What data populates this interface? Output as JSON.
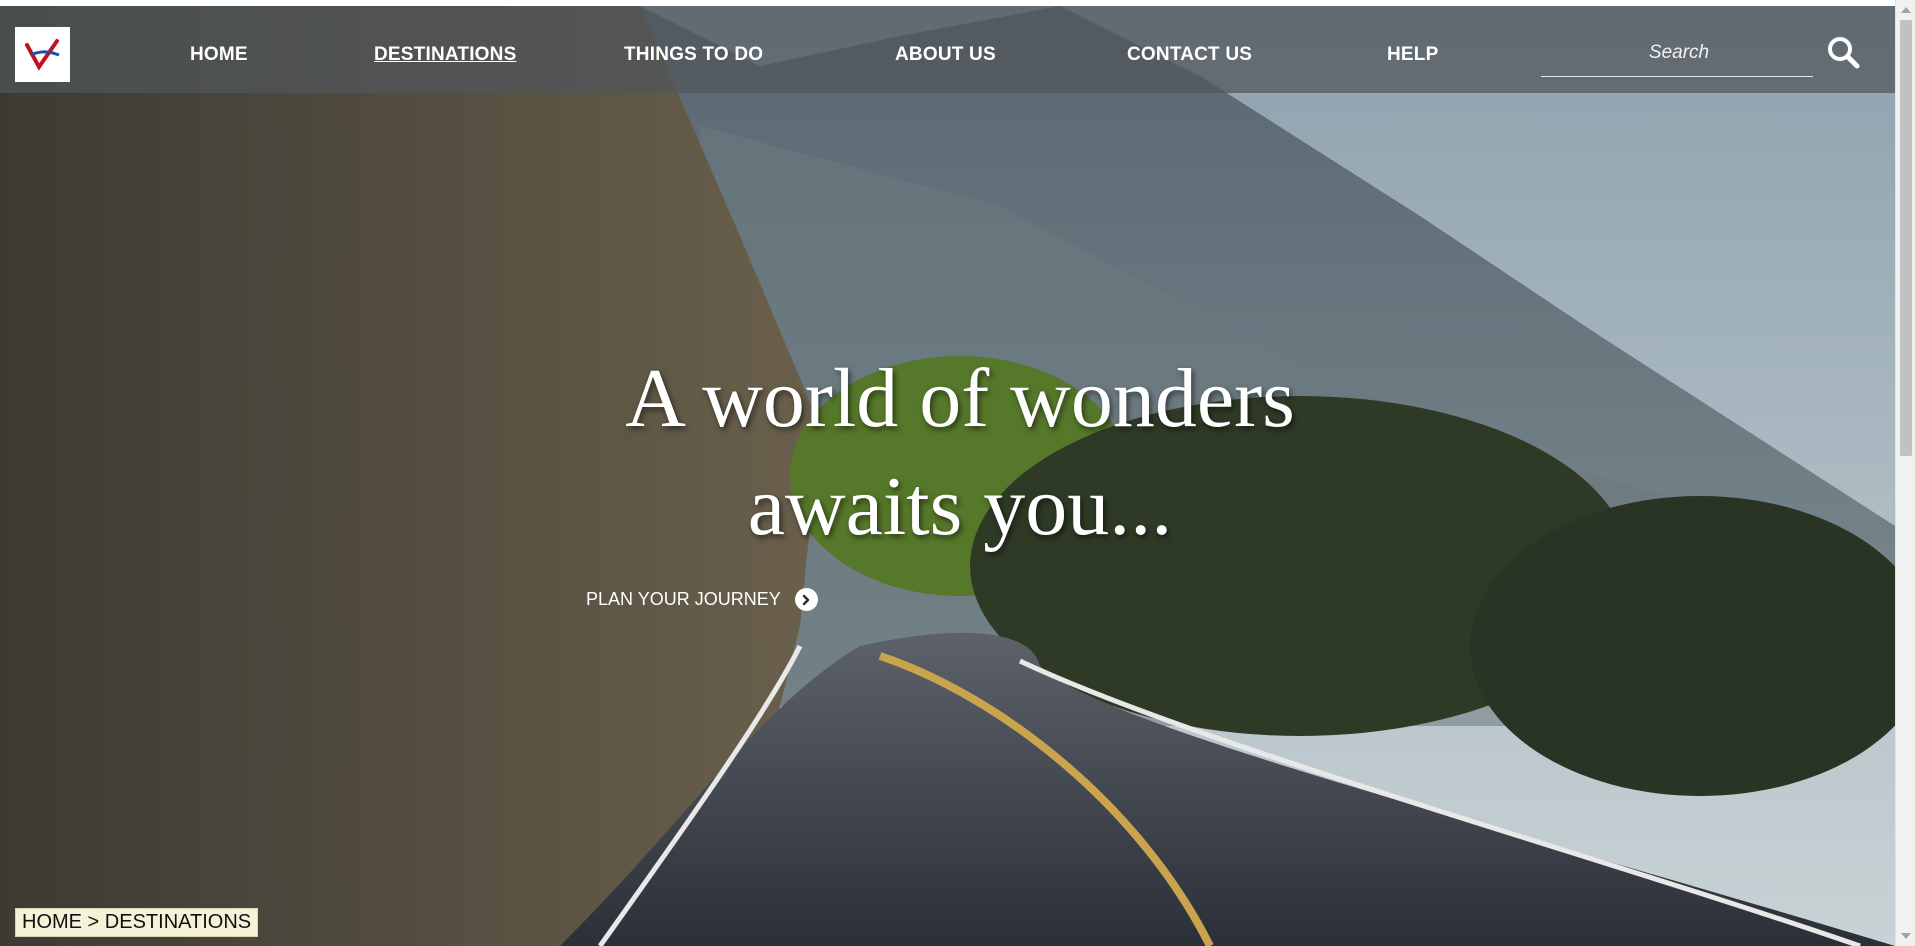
{
  "nav": {
    "items": [
      {
        "label": "HOME"
      },
      {
        "label": "DESTINATIONS",
        "active": true
      },
      {
        "label": "THINGS TO DO"
      },
      {
        "label": "ABOUT US"
      },
      {
        "label": "CONTACT US"
      },
      {
        "label": "HELP"
      }
    ]
  },
  "search": {
    "placeholder": "Search",
    "icon": "search-icon"
  },
  "hero": {
    "line1": "A world of wonders",
    "line2": "awaits you...",
    "cta_label": "PLAN YOUR JOURNEY",
    "cta_icon": "chevron-right-circle-icon"
  },
  "breadcrumb": {
    "text": "HOME > DESTINATIONS"
  },
  "colors": {
    "nav_bg": "#50565a",
    "breadcrumb_bg": "#f6f2d8",
    "text": "#ffffff"
  }
}
